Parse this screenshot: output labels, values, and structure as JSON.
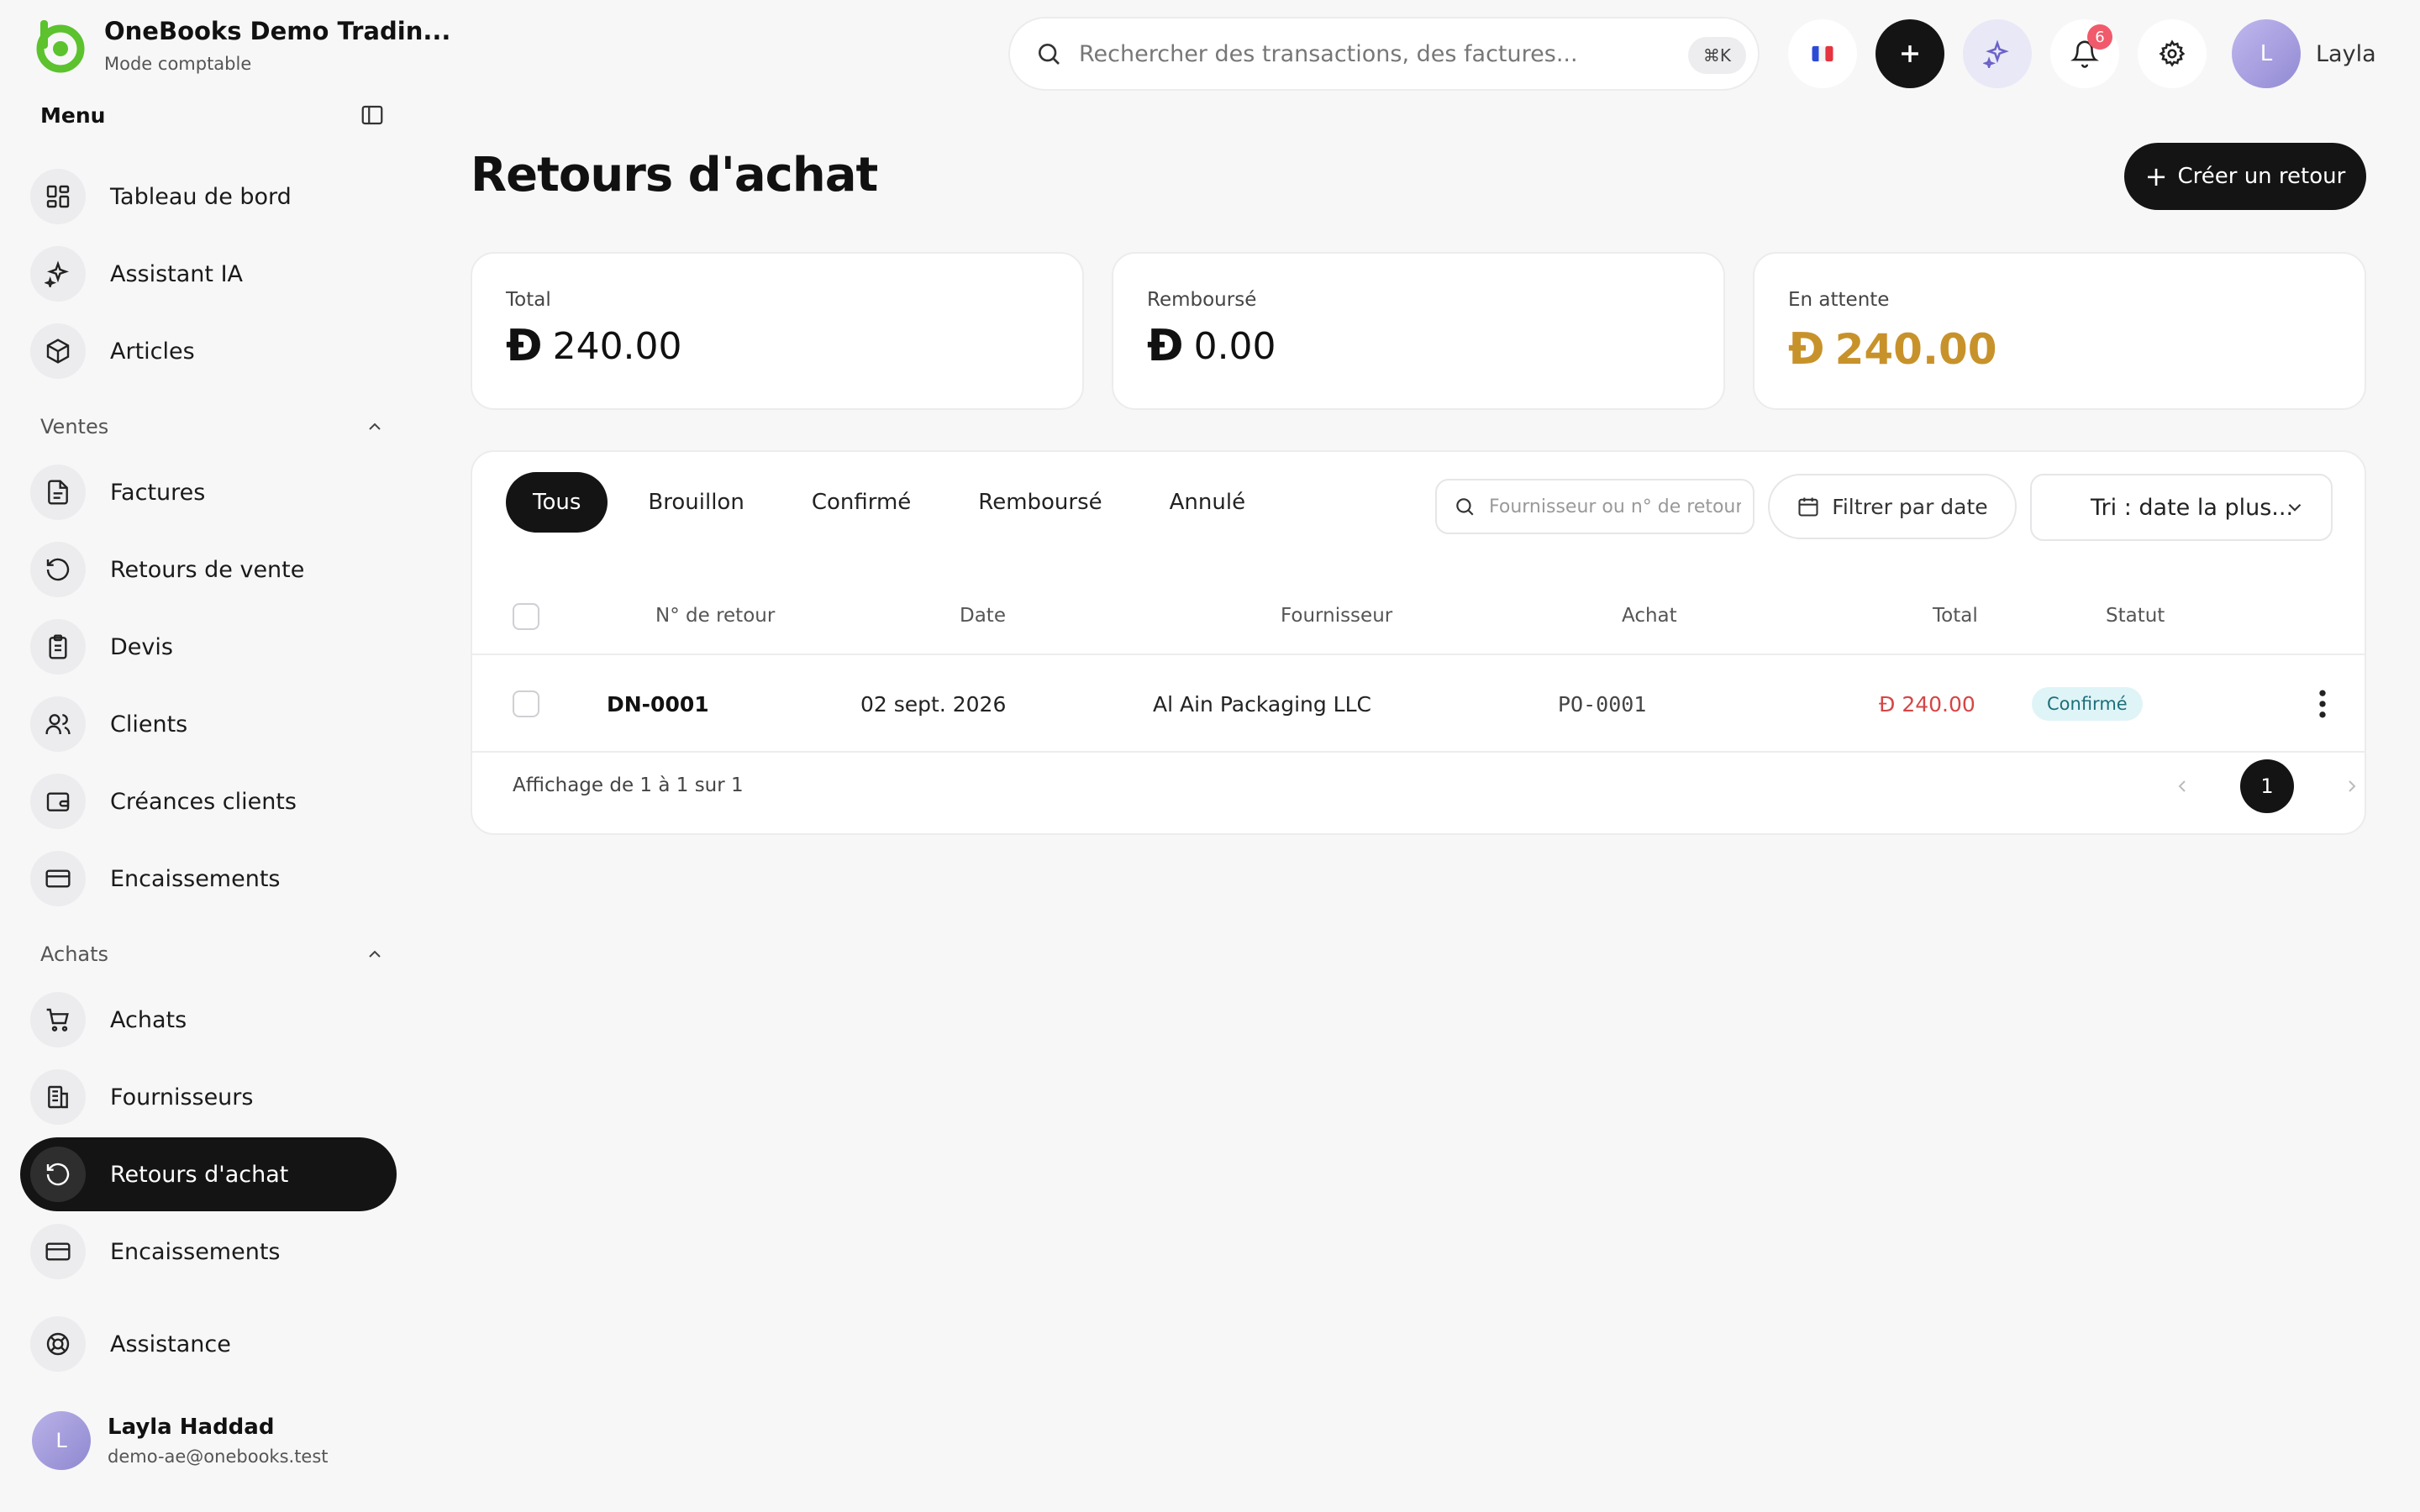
{
  "brand": {
    "name": "OneBooks Demo Tradin...",
    "mode": "Mode comptable"
  },
  "menu": {
    "title": "Menu"
  },
  "nav": {
    "top": [
      {
        "label": "Tableau de bord",
        "icon": "dashboard-icon"
      },
      {
        "label": "Assistant IA",
        "icon": "sparkles-icon"
      },
      {
        "label": "Articles",
        "icon": "box-icon"
      }
    ],
    "sales_title": "Ventes",
    "sales": [
      {
        "label": "Factures",
        "icon": "file-icon"
      },
      {
        "label": "Retours de vente",
        "icon": "rotate-icon"
      },
      {
        "label": "Devis",
        "icon": "clipboard-icon"
      },
      {
        "label": "Clients",
        "icon": "users-icon"
      },
      {
        "label": "Créances clients",
        "icon": "wallet-icon"
      },
      {
        "label": "Encaissements",
        "icon": "card-icon"
      }
    ],
    "purchases_title": "Achats",
    "purchases": [
      {
        "label": "Achats",
        "icon": "cart-icon"
      },
      {
        "label": "Fournisseurs",
        "icon": "building-icon"
      },
      {
        "label": "Retours d'achat",
        "icon": "rotate-icon",
        "active": true
      },
      {
        "label": "Encaissements",
        "icon": "card-icon"
      }
    ],
    "support": {
      "label": "Assistance",
      "icon": "lifebuoy-icon"
    }
  },
  "user": {
    "initial": "L",
    "name": "Layla Haddad",
    "email": "demo-ae@onebooks.test",
    "short": "Layla"
  },
  "search": {
    "placeholder": "Rechercher des transactions, des factures...",
    "shortcut": "⌘K"
  },
  "notifications": {
    "count": "6"
  },
  "page": {
    "title": "Retours d'achat",
    "create_label": "Créer un retour"
  },
  "cards": {
    "total": {
      "label": "Total",
      "currency": "Đ",
      "value": "240.00"
    },
    "refunded": {
      "label": "Remboursé",
      "currency": "Đ",
      "value": "0.00"
    },
    "pending": {
      "label": "En attente",
      "currency": "Đ",
      "value": "240.00"
    }
  },
  "tabs": [
    "Tous",
    "Brouillon",
    "Confirmé",
    "Remboursé",
    "Annulé"
  ],
  "filters": {
    "search_placeholder": "Fournisseur ou n° de retour",
    "date_label": "Filtrer par date",
    "sort_label": "Tri : date la plus..."
  },
  "table": {
    "headers": {
      "number": "N° de retour",
      "date": "Date",
      "supplier": "Fournisseur",
      "purchase": "Achat",
      "total": "Total",
      "status": "Statut"
    },
    "rows": [
      {
        "number": "DN-0001",
        "date": "02 sept. 2026",
        "supplier": "Al Ain Packaging LLC",
        "purchase": "PO-0001",
        "currency": "Đ",
        "total": "240.00",
        "status": "Confirmé"
      }
    ]
  },
  "pagination": {
    "summary": "Affichage de 1 à 1 sur 1",
    "page": "1"
  },
  "colors": {
    "accent": "#141414",
    "brand_green": "#5cc22d",
    "pending": "#c8922b",
    "negative": "#d64545"
  }
}
